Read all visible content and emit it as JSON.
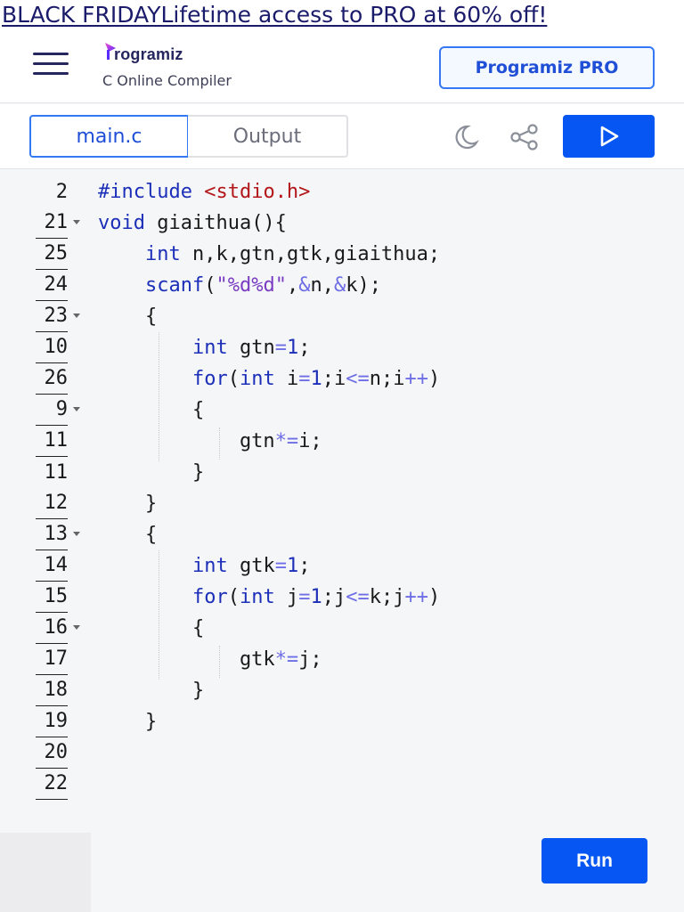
{
  "promo": {
    "text": "BLACK FRIDAYLifetime access to PRO at 60% off!"
  },
  "header": {
    "logo": "rogramiz",
    "subtitle": "C Online Compiler",
    "pro_button": "Programiz PRO"
  },
  "toolbar": {
    "tabs": [
      {
        "label": "main.c"
      },
      {
        "label": "Output"
      }
    ],
    "icons": [
      "moon-icon",
      "share-icon",
      "play-icon"
    ]
  },
  "editor": {
    "line_numbers": [
      "2",
      "21",
      "25",
      "24",
      "23",
      "10",
      "26",
      "9",
      "11",
      "11",
      "12",
      "13",
      "14",
      "15",
      "16",
      "17",
      "18",
      "19",
      "20",
      "22"
    ],
    "lines": [
      "#include <stdio.h>",
      "void giaithua(){",
      "    int n,k,gtn,gtk,giaithua;",
      "    scanf(\"%d%d\",&n,&k);",
      "    {",
      "        int gtn=1;",
      "        for(int i=1;i<=n;i++)",
      "        {",
      "            gtn*=i;",
      "        }",
      "    }",
      "    {",
      "        int gtk=1;",
      "        for(int j=1;j<=k;j++)",
      "        {",
      "            gtk*=j;",
      "        }",
      "    }",
      "",
      ""
    ]
  },
  "run_button": "Run",
  "colors": {
    "accent": "#0556f3",
    "brand": "#25265e"
  }
}
